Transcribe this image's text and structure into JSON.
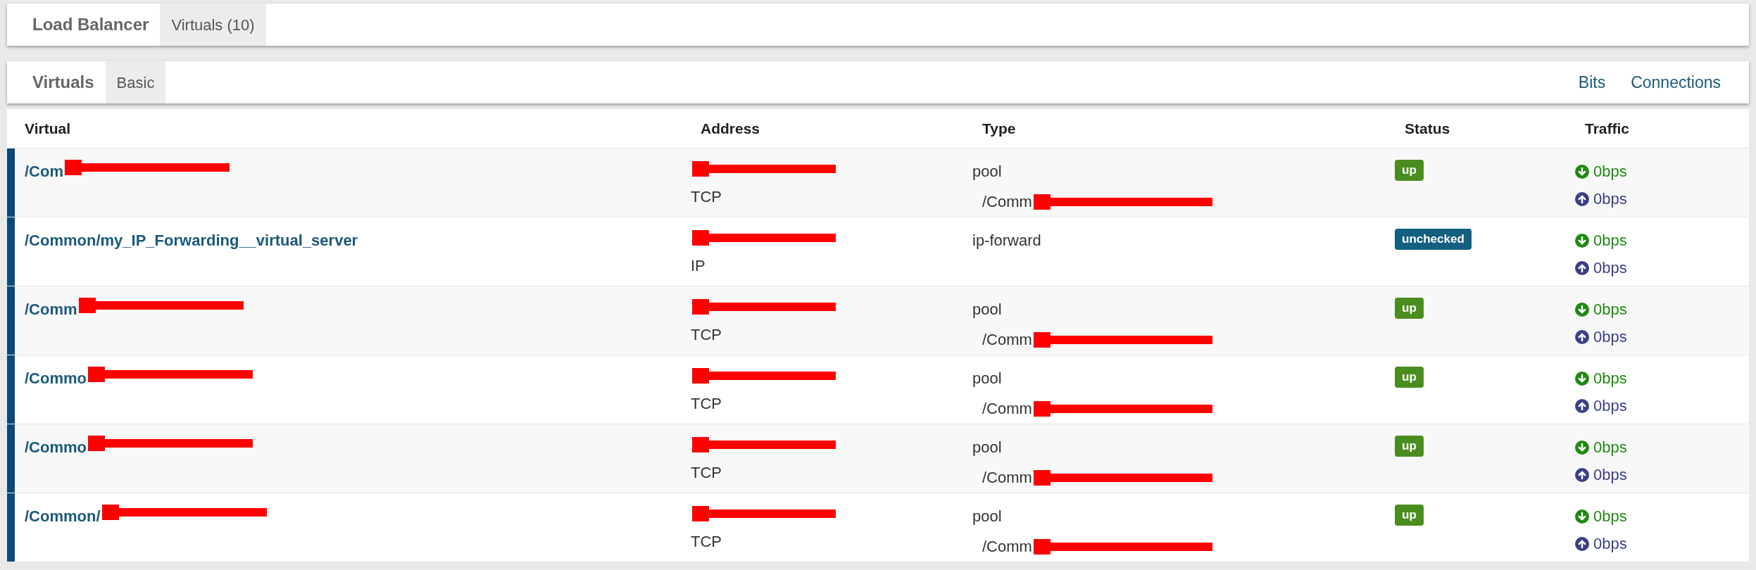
{
  "breadcrumb": [
    {
      "label": "Load Balancer",
      "selected": false
    },
    {
      "label": "Virtuals (10)",
      "selected": true
    }
  ],
  "subnav": {
    "tabs": [
      {
        "label": "Virtuals",
        "selected": false
      },
      {
        "label": "Basic",
        "selected": true
      }
    ],
    "links": [
      "Bits",
      "Connections"
    ]
  },
  "table": {
    "columns": [
      "Virtual",
      "Address",
      "Type",
      "Status",
      "Traffic"
    ],
    "rows": [
      {
        "virtual": "/Com",
        "virtual_redacted": true,
        "address_redacted": true,
        "protocol": "TCP",
        "type": "pool",
        "pool": "/Comm",
        "pool_redacted": true,
        "status": "up",
        "color": "#4a8d1f",
        "traffic_in": "0bps",
        "traffic_out": "0bps"
      },
      {
        "virtual": "/Common/my_IP_Forwarding__virtual_server",
        "address_redacted": true,
        "protocol": "IP",
        "type": "ip-forward",
        "status": "unchecked",
        "color": "#135f80",
        "traffic_in": "0bps",
        "traffic_out": "0bps"
      },
      {
        "virtual": "/Comm",
        "virtual_redacted": true,
        "address_redacted": true,
        "protocol": "TCP",
        "type": "pool",
        "pool": "/Comm",
        "pool_redacted": true,
        "status": "up",
        "color": "#4a8d1f",
        "traffic_in": "0bps",
        "traffic_out": "0bps"
      },
      {
        "virtual": "/Commo",
        "virtual_redacted": true,
        "address_redacted": true,
        "protocol": "TCP",
        "type": "pool",
        "pool": "/Comm",
        "pool_redacted": true,
        "status": "up",
        "color": "#4a8d1f",
        "traffic_in": "0bps",
        "traffic_out": "0bps"
      },
      {
        "virtual": "/Commo",
        "virtual_redacted": true,
        "address_redacted": true,
        "protocol": "TCP",
        "type": "pool",
        "pool": "/Comm",
        "pool_redacted": true,
        "status": "up",
        "color": "#4a8d1f",
        "traffic_in": "0bps",
        "traffic_out": "0bps"
      },
      {
        "virtual": "/Common/",
        "virtual_redacted": true,
        "address_redacted": true,
        "protocol": "TCP",
        "type": "pool",
        "pool": "/Comm",
        "pool_redacted": true,
        "status": "up",
        "color": "#4a8d1f",
        "traffic_in": "0bps",
        "traffic_out": "0bps"
      }
    ]
  }
}
